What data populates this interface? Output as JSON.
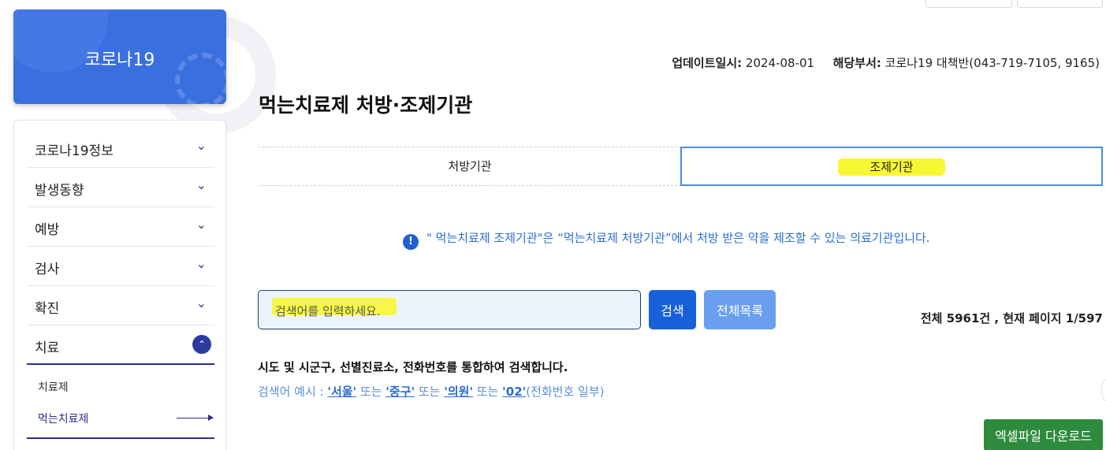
{
  "sidebar": {
    "card_title": "코로나19",
    "items": [
      {
        "label": "코로나19정보",
        "icon": "chevron-down-icon"
      },
      {
        "label": "발생동향",
        "icon": "chevron-down-icon"
      },
      {
        "label": "예방",
        "icon": "chevron-down-icon"
      },
      {
        "label": "검사",
        "icon": "chevron-down-icon"
      },
      {
        "label": "확진",
        "icon": "chevron-down-icon"
      },
      {
        "label": "치료",
        "icon": "chevron-up-icon"
      }
    ],
    "sub_items": [
      {
        "label": "치료제"
      },
      {
        "label": "먹는치료제"
      }
    ]
  },
  "meta": {
    "update_label": "업데이트일시:",
    "update_value": "2024-08-01",
    "dept_label": "해당부서:",
    "dept_value": "코로나19 대책반(043-719-7105, 9165)"
  },
  "page_title": "먹는치료제 처방·조제기관",
  "tabs": [
    {
      "label": "처방기관",
      "active": false
    },
    {
      "label": "조제기관",
      "active": true
    }
  ],
  "notice": "\" 먹는치료제 조제기관\"은 “먹는치료제 처방기관”에서 처방 받은 약을 제조할 수 있는 의료기관입니다.",
  "search": {
    "placeholder": "검색어를 입력하세요.",
    "search_label": "검색",
    "all_label": "전체목록"
  },
  "counts": "전체 5961건 ,  현재 페이지 1/597",
  "hint": {
    "line1": "시도 및 시군구, 선별진료소, 전화번호를 통합하여 검색합니다.",
    "prefix": "검색어 예시 : ",
    "kw1": "'서울'",
    "or1": " 또는 ",
    "kw2": "'중구'",
    "or2": " 또는 ",
    "kw3": "'의원'",
    "or3": " 또는 ",
    "kw4": "'02'",
    "suffix": "(전화번호 일부)"
  },
  "excel_label": "엑셀파일 다운로드",
  "colors": {
    "primary": "#1660d8",
    "card": "#3a6fe0",
    "excel": "#2e8b3e",
    "highlight": "#f7f733"
  }
}
